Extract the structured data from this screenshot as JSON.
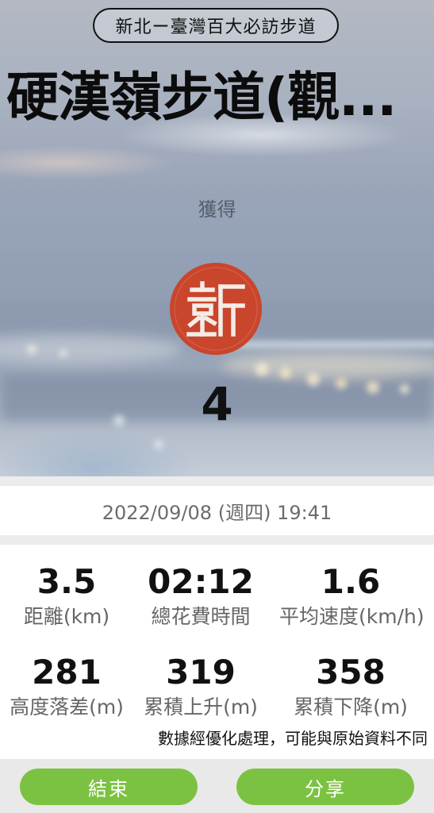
{
  "header": {
    "badge": "新北ー臺灣百大必訪步道",
    "title": "硬漢嶺步道(觀...",
    "obtained_label": "獲得",
    "stamp_icon": "seal-stamp-icon",
    "stamp_color": "#c9452c",
    "stamp_count": "4"
  },
  "record": {
    "datetime": "2022/09/08 (週四) 19:41"
  },
  "stats": {
    "distance": {
      "value": "3.5",
      "label": "距離(km)"
    },
    "total_time": {
      "value": "02:12",
      "label": "總花費時間"
    },
    "avg_speed": {
      "value": "1.6",
      "label": "平均速度(km/h)"
    },
    "elevation_diff": {
      "value": "281",
      "label": "高度落差(m)"
    },
    "total_ascent": {
      "value": "319",
      "label": "累積上升(m)"
    },
    "total_descent": {
      "value": "358",
      "label": "累積下降(m)"
    },
    "note": "數據經優化處理，可能與原始資料不同"
  },
  "footer": {
    "end_label": "結束",
    "share_label": "分享",
    "accent": "#7cc242"
  }
}
